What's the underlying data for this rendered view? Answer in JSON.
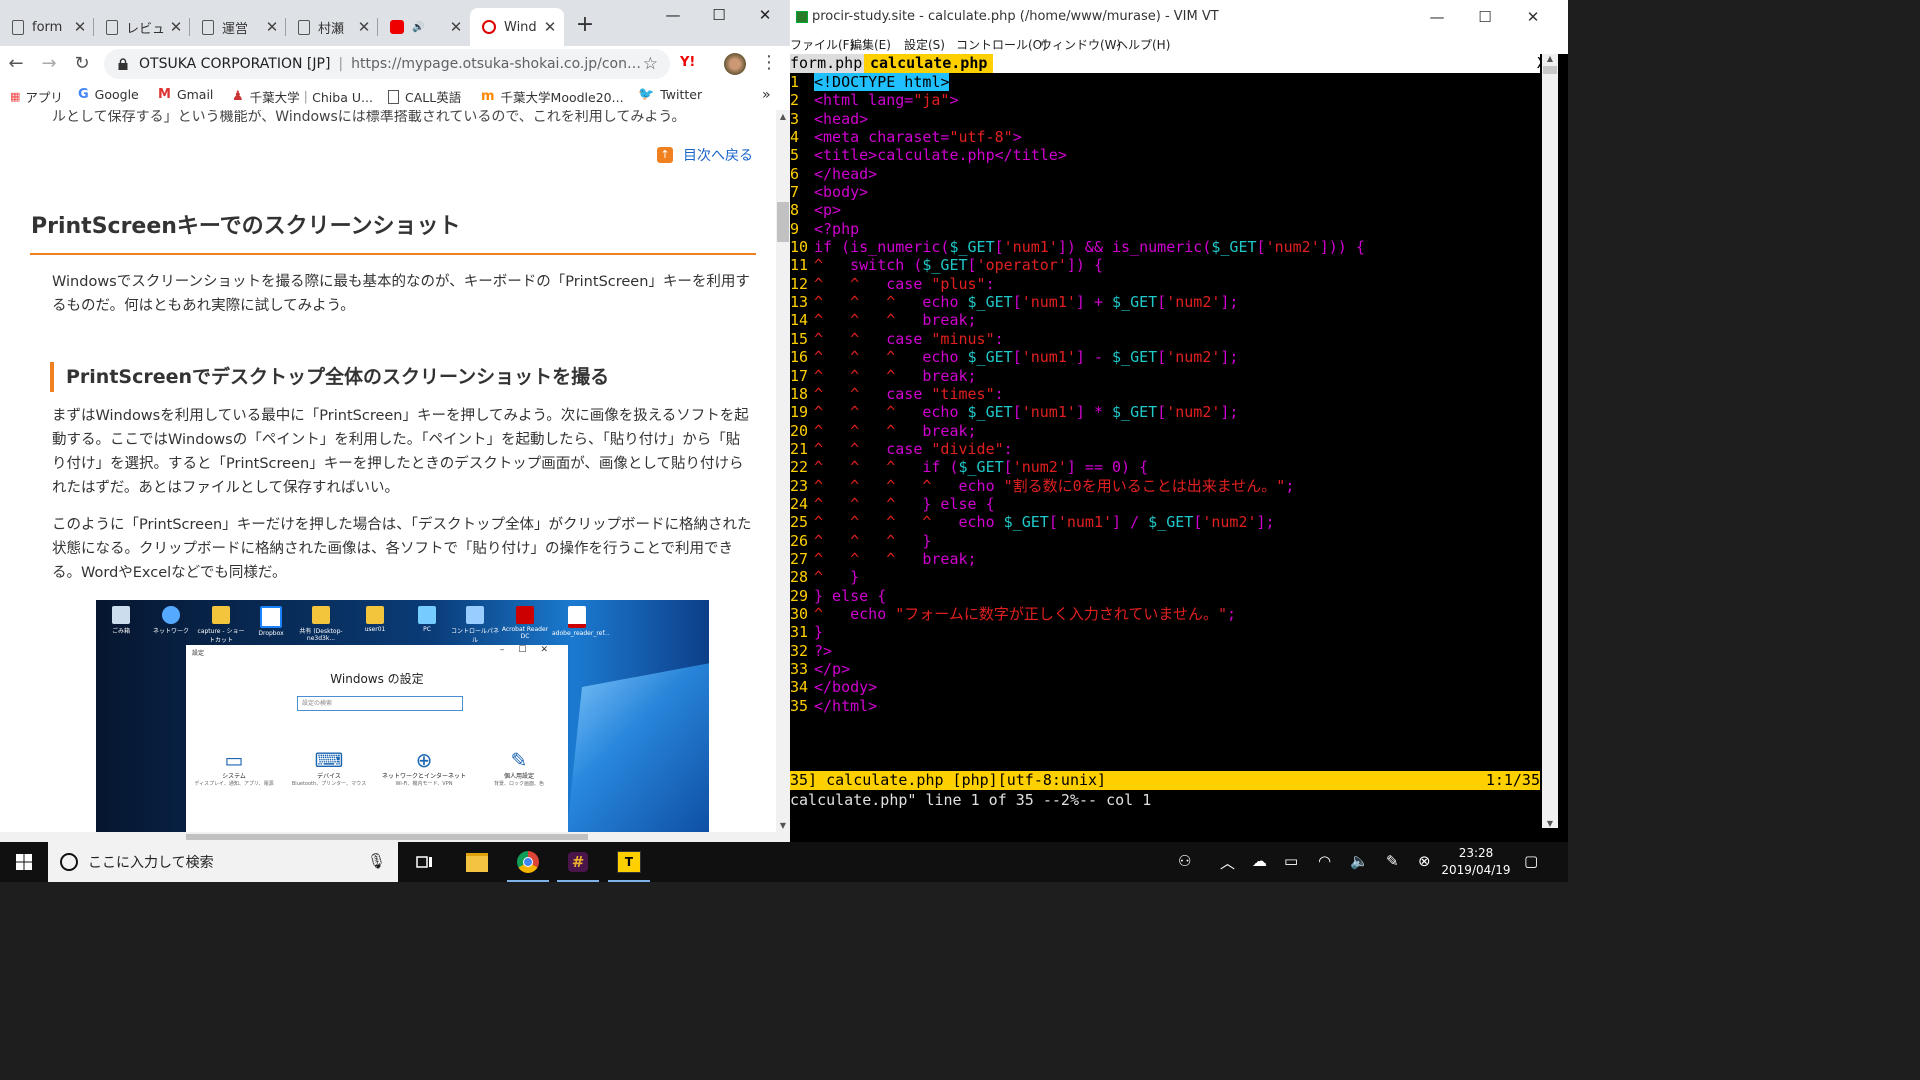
{
  "chrome": {
    "tabs": [
      {
        "title": "form",
        "icon": "document-icon"
      },
      {
        "title": "レビュ",
        "icon": "document-icon"
      },
      {
        "title": "運営",
        "icon": "document-icon"
      },
      {
        "title": "村瀬",
        "icon": "document-icon"
      },
      {
        "title": "",
        "icon": "youtube-icon"
      },
      {
        "title": "Wind",
        "icon": "site-icon"
      }
    ],
    "window_controls": {
      "minimize": "—",
      "maximize": "☐",
      "close": "✕"
    },
    "address": {
      "site_name": "OTSUKA CORPORATION [JP]",
      "separator": "|",
      "url": "https://mypage.otsuka-shokai.co.jp/content..."
    },
    "bookmarks": [
      {
        "label": "アプリ",
        "icon": "apps-grid-icon"
      },
      {
        "label": "Google",
        "icon": "google-icon"
      },
      {
        "label": "Gmail",
        "icon": "gmail-icon"
      },
      {
        "label": "千葉大学｜Chiba U...",
        "icon": "chiba-univ-icon"
      },
      {
        "label": "CALL英語",
        "icon": "document-icon"
      },
      {
        "label": "千葉大学Moodle20...",
        "icon": "moodle-icon"
      },
      {
        "label": "Twitter",
        "icon": "twitter-icon"
      }
    ],
    "bookmarks_more": "»"
  },
  "article": {
    "cut_text": "ルとして保存する」という機能が、Windowsには標準搭載されているので、これを利用してみよう。",
    "toc_link": "目次へ戻る",
    "h2": "PrintScreenキーでのスクリーンショット",
    "p1": "Windowsでスクリーンショットを撮る際に最も基本的なのが、キーボードの「PrintScreen」キーを利用するものだ。何はともあれ実際に試してみよう。",
    "h3": "PrintScreenでデスクトップ全体のスクリーンショットを撮る",
    "p2": "まずはWindowsを利用している最中に「PrintScreen」キーを押してみよう。次に画像を扱えるソフトを起動する。ここではWindowsの「ペイント」を利用した。「ペイント」を起動したら、「貼り付け」から「貼り付け」を選択。すると「PrintScreen」キーを押したときのデスクトップ画面が、画像として貼り付けられたはずだ。あとはファイルとして保存すればいい。",
    "p3": "このように「PrintScreen」キーだけを押した場合は、「デスクトップ全体」がクリップボードに格納された状態になる。クリップボードに格納された画像は、各ソフトで「貼り付け」の操作を行うことで利用できる。WordやExcelなどでも同様だ。",
    "screenshot": {
      "desktop_icons": [
        "ごみ箱",
        "ネットワーク",
        "capture - ショートカット",
        "Dropbox",
        "共有 (Desktop-ne3d3k...",
        "user01",
        "PC",
        "コントロールパネル",
        "Acrobat Reader DC",
        "adobe_reader_ref..."
      ],
      "window_title": "設定",
      "heading": "Windows の設定",
      "search_placeholder": "設定の検索",
      "categories": [
        {
          "name": "システム",
          "sub": "ディスプレイ、通知、アプリ、電源"
        },
        {
          "name": "デバイス",
          "sub": "Bluetooth、プリンター、マウス"
        },
        {
          "name": "ネットワークとインターネット",
          "sub": "Wi-Fi、機内モード、VPN"
        },
        {
          "name": "個人用設定",
          "sub": "背景、ロック画面、色"
        }
      ]
    }
  },
  "vim": {
    "title": "procir-study.site - calculate.php (/home/www/murase) - VIM VT",
    "menu": [
      "ファイル(F)",
      "編集(E)",
      "設定(S)",
      "コントロール(O)",
      "ウィンドウ(W)",
      "ヘルプ(H)"
    ],
    "tabs": [
      "form.php",
      "calculate.php"
    ],
    "tab_close": "X",
    "status_left": "35] calculate.php [php][utf-8:unix]",
    "status_right": "1:1/35",
    "cmdline": "calculate.php\" line 1 of 35 --2%-- col 1"
  },
  "taskbar": {
    "search_placeholder": "ここに入力して検索",
    "apps": [
      "task-view-icon",
      "file-explorer-icon",
      "chrome-icon",
      "slack-icon",
      "teraterm-icon"
    ],
    "time": "23:28",
    "date": "2019/04/19"
  }
}
